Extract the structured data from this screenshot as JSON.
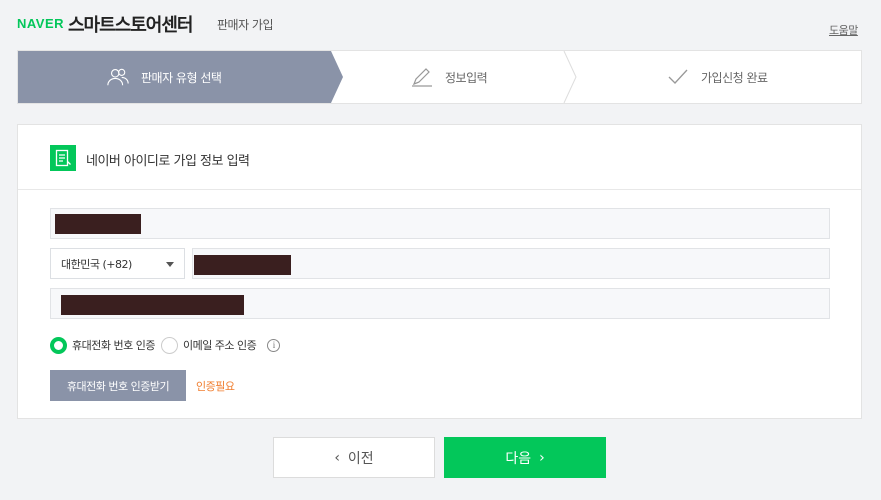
{
  "header": {
    "logo_brand": "NAVER",
    "logo_title": "스마트스토어센터",
    "logo_subtitle": "판매자 가입",
    "help_link": "도움말"
  },
  "steps": [
    {
      "label": "판매자 유형 선택",
      "icon": "users-icon",
      "active": true
    },
    {
      "label": "정보입력",
      "icon": "pencil-icon",
      "active": false
    },
    {
      "label": "가입신청 완료",
      "icon": "check-icon",
      "active": false
    }
  ],
  "form": {
    "title": "네이버 아이디로 가입 정보 입력",
    "title_icon": "document-icon",
    "country_select": "대한민국 (+82)",
    "radio_options": [
      {
        "label": "휴대전화 번호 인증",
        "selected": true
      },
      {
        "label": "이메일 주소 인증",
        "selected": false
      }
    ],
    "verify_button": "휴대전화 번호 인증받기",
    "verify_status": "인증필요"
  },
  "footer": {
    "prev_label": "이전",
    "next_label": "다음"
  },
  "colors": {
    "brand_green": "#03c75a",
    "active_step": "#8a93a8",
    "warning": "#f07d2e"
  }
}
